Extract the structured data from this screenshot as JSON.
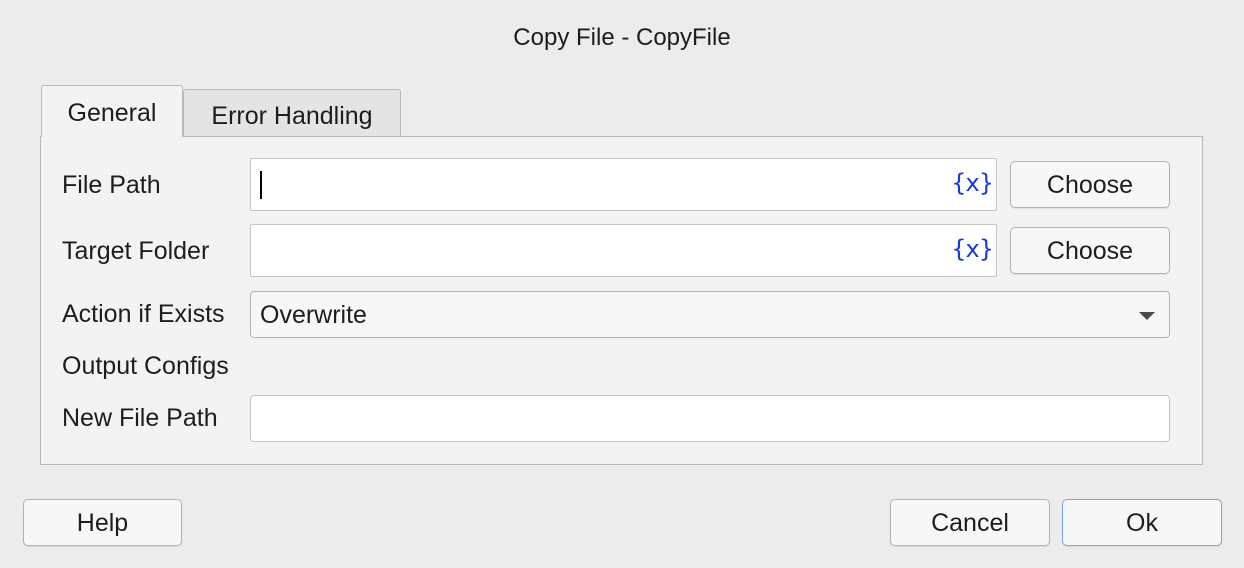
{
  "window": {
    "title": "Copy File - CopyFile"
  },
  "tabs": [
    {
      "label": "General",
      "active": true
    },
    {
      "label": "Error Handling",
      "active": false
    }
  ],
  "form": {
    "file_path": {
      "label": "File Path",
      "value": "",
      "variable_icon": "{x}",
      "button": "Choose"
    },
    "target_folder": {
      "label": "Target Folder",
      "value": "",
      "variable_icon": "{x}",
      "button": "Choose"
    },
    "action_if_exists": {
      "label": "Action if Exists",
      "selected": "Overwrite"
    },
    "output_section": {
      "label": "Output Configs"
    },
    "new_file_path": {
      "label": "New File Path",
      "value": ""
    }
  },
  "footer": {
    "help": "Help",
    "cancel": "Cancel",
    "ok": "Ok"
  },
  "colors": {
    "background": "#ececec",
    "panel": "#f3f3f3",
    "variable_icon": "#1a3bd6",
    "default_button_border": "#7aa6e3"
  }
}
